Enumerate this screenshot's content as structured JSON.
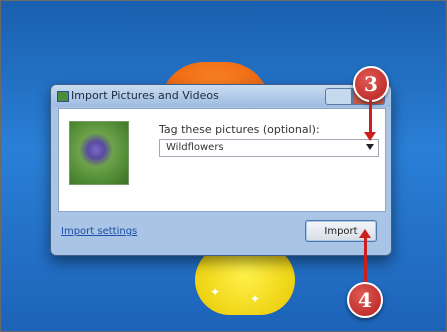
{
  "dialog": {
    "title": "Import Pictures and Videos",
    "tag_label": "Tag these pictures (optional):",
    "tag_value": "Wildflowers",
    "import_settings_link": "Import settings",
    "import_button": "Import"
  },
  "callouts": {
    "step3": "3",
    "step4": "4"
  },
  "colors": {
    "callout": "#cc1f1f",
    "link": "#1c4fa6",
    "dialog_frame": "#a9c4e4"
  }
}
